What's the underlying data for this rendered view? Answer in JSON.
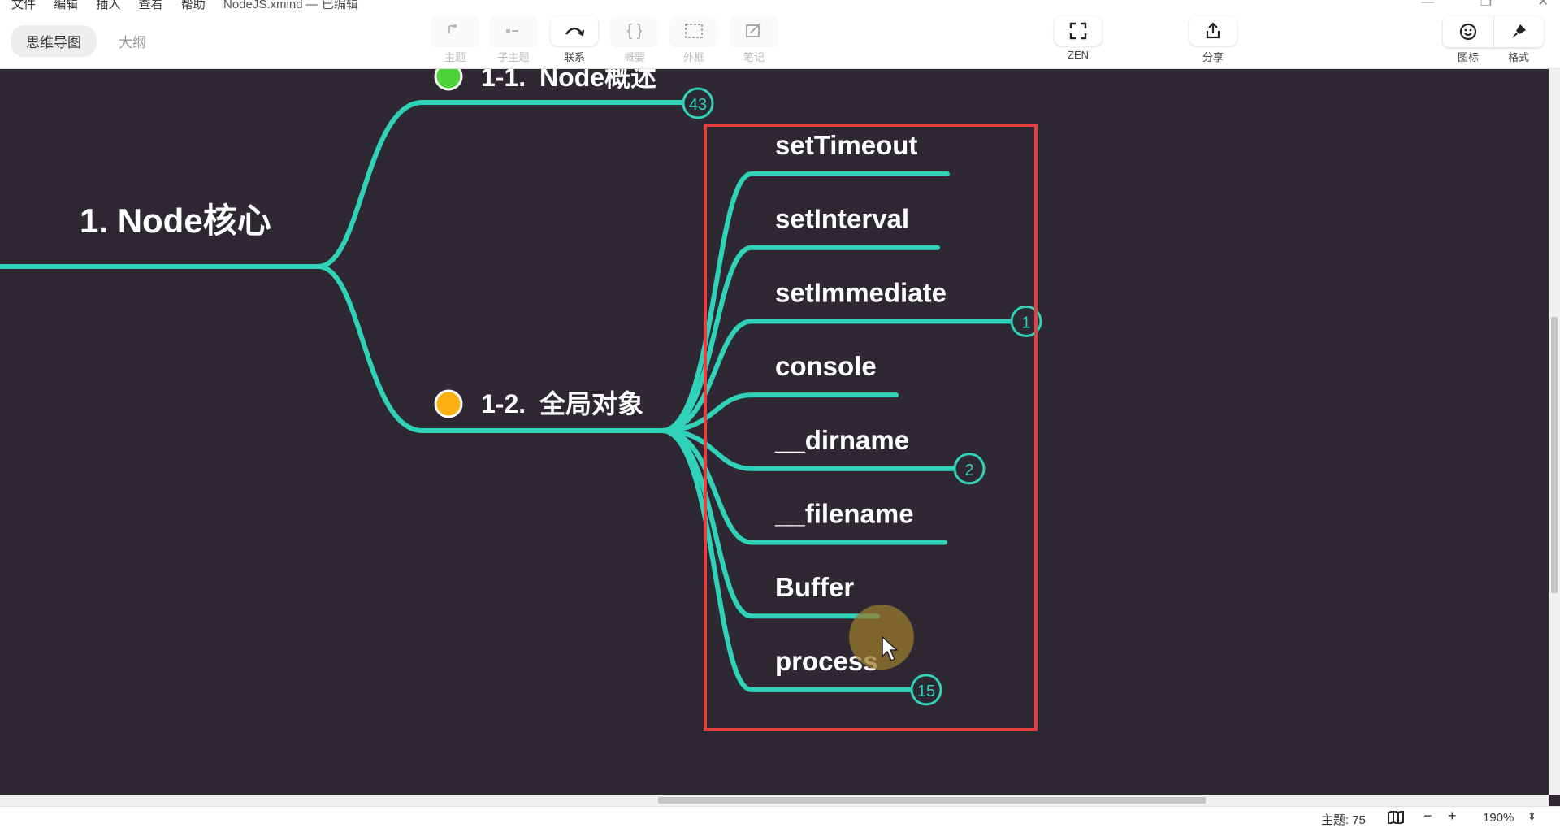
{
  "menu": [
    "文件",
    "编辑",
    "插入",
    "查看",
    "帮助"
  ],
  "file_title": "NodeJS.xmind — 已编辑",
  "view_tabs": [
    {
      "label": "思维导图",
      "active": true
    },
    {
      "label": "大纲",
      "active": false
    }
  ],
  "toolbar": {
    "topic": "主题",
    "subtopic": "子主题",
    "relationship": "联系",
    "summary": "概要",
    "boundary": "外框",
    "note": "笔记",
    "zen": "ZEN",
    "share": "分享",
    "icon": "图标",
    "format": "格式"
  },
  "map": {
    "central": {
      "label": "1. Node核心"
    },
    "branches": [
      {
        "prefix": "1-1.",
        "label": "Node概述",
        "marker_color": "#4cd137",
        "badge": "43"
      },
      {
        "prefix": "1-2.",
        "label": "全局对象",
        "marker_color": "#fbb00f",
        "badge": ""
      }
    ],
    "subtopics": [
      {
        "label": "setTimeout",
        "badge": ""
      },
      {
        "label": "setInterval",
        "badge": ""
      },
      {
        "label": "setImmediate",
        "badge": "1"
      },
      {
        "label": "console",
        "badge": ""
      },
      {
        "label": "__dirname",
        "badge": "2"
      },
      {
        "label": "__filename",
        "badge": ""
      },
      {
        "label": "Buffer",
        "badge": ""
      },
      {
        "label": "process",
        "badge": "15"
      }
    ],
    "line_color": "#30d3b9",
    "highlight_color": "#e84040",
    "background": "#2d2832"
  },
  "status": {
    "topic_count": "主题: 75",
    "zoom": "190%"
  }
}
